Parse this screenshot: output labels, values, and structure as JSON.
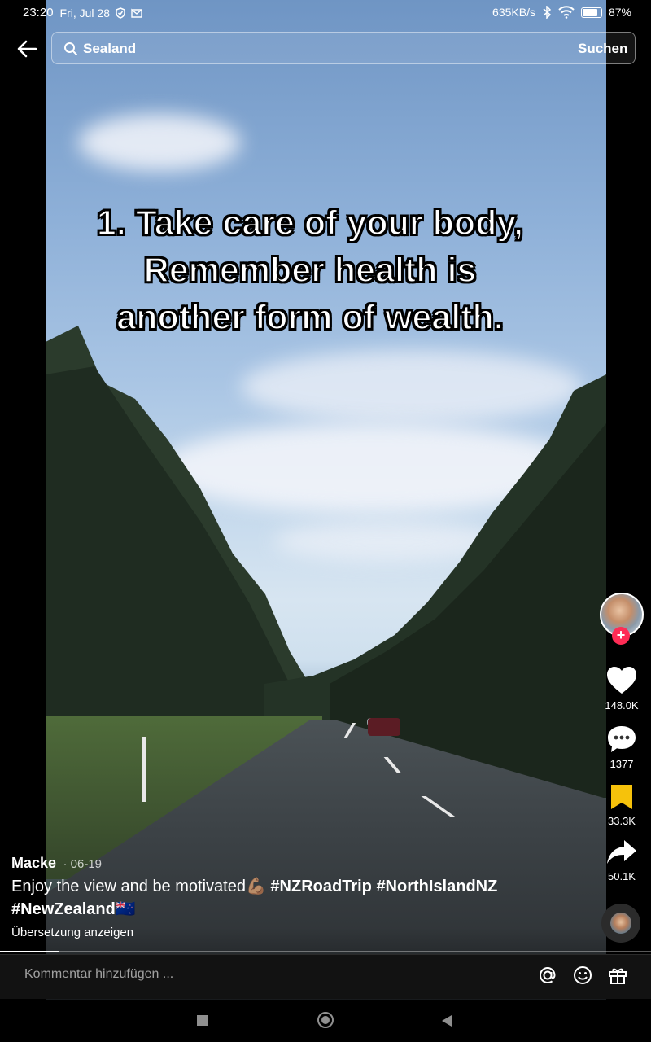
{
  "status_bar": {
    "time": "23:20",
    "date": "Fri, Jul 28",
    "network_speed": "635KB/s",
    "battery_percent": "87%"
  },
  "search": {
    "value": "Sealand",
    "submit_label": "Suchen"
  },
  "video": {
    "overlay_lines": [
      "1. Take care of your body,",
      "Remember health is",
      "another form of wealth."
    ],
    "progress": 0.09
  },
  "actions": {
    "likes": "148.0K",
    "comments": "1377",
    "favorites": "33.3K",
    "shares": "50.1K"
  },
  "post": {
    "author": "Macke",
    "date": "· 06-19",
    "description_text": "Enjoy the view and be motivated💪🏽",
    "hashtags": [
      "#NZRoadTrip",
      "#NorthIslandNZ",
      "#NewZealand"
    ],
    "flag": "🇳🇿",
    "translate_label": "Übersetzung anzeigen"
  },
  "comment_bar": {
    "placeholder": "Kommentar hinzufügen ..."
  },
  "colors": {
    "follow_badge": "#fe2c55",
    "favorite": "#f6c20b",
    "sky": "#a9c5e4"
  }
}
